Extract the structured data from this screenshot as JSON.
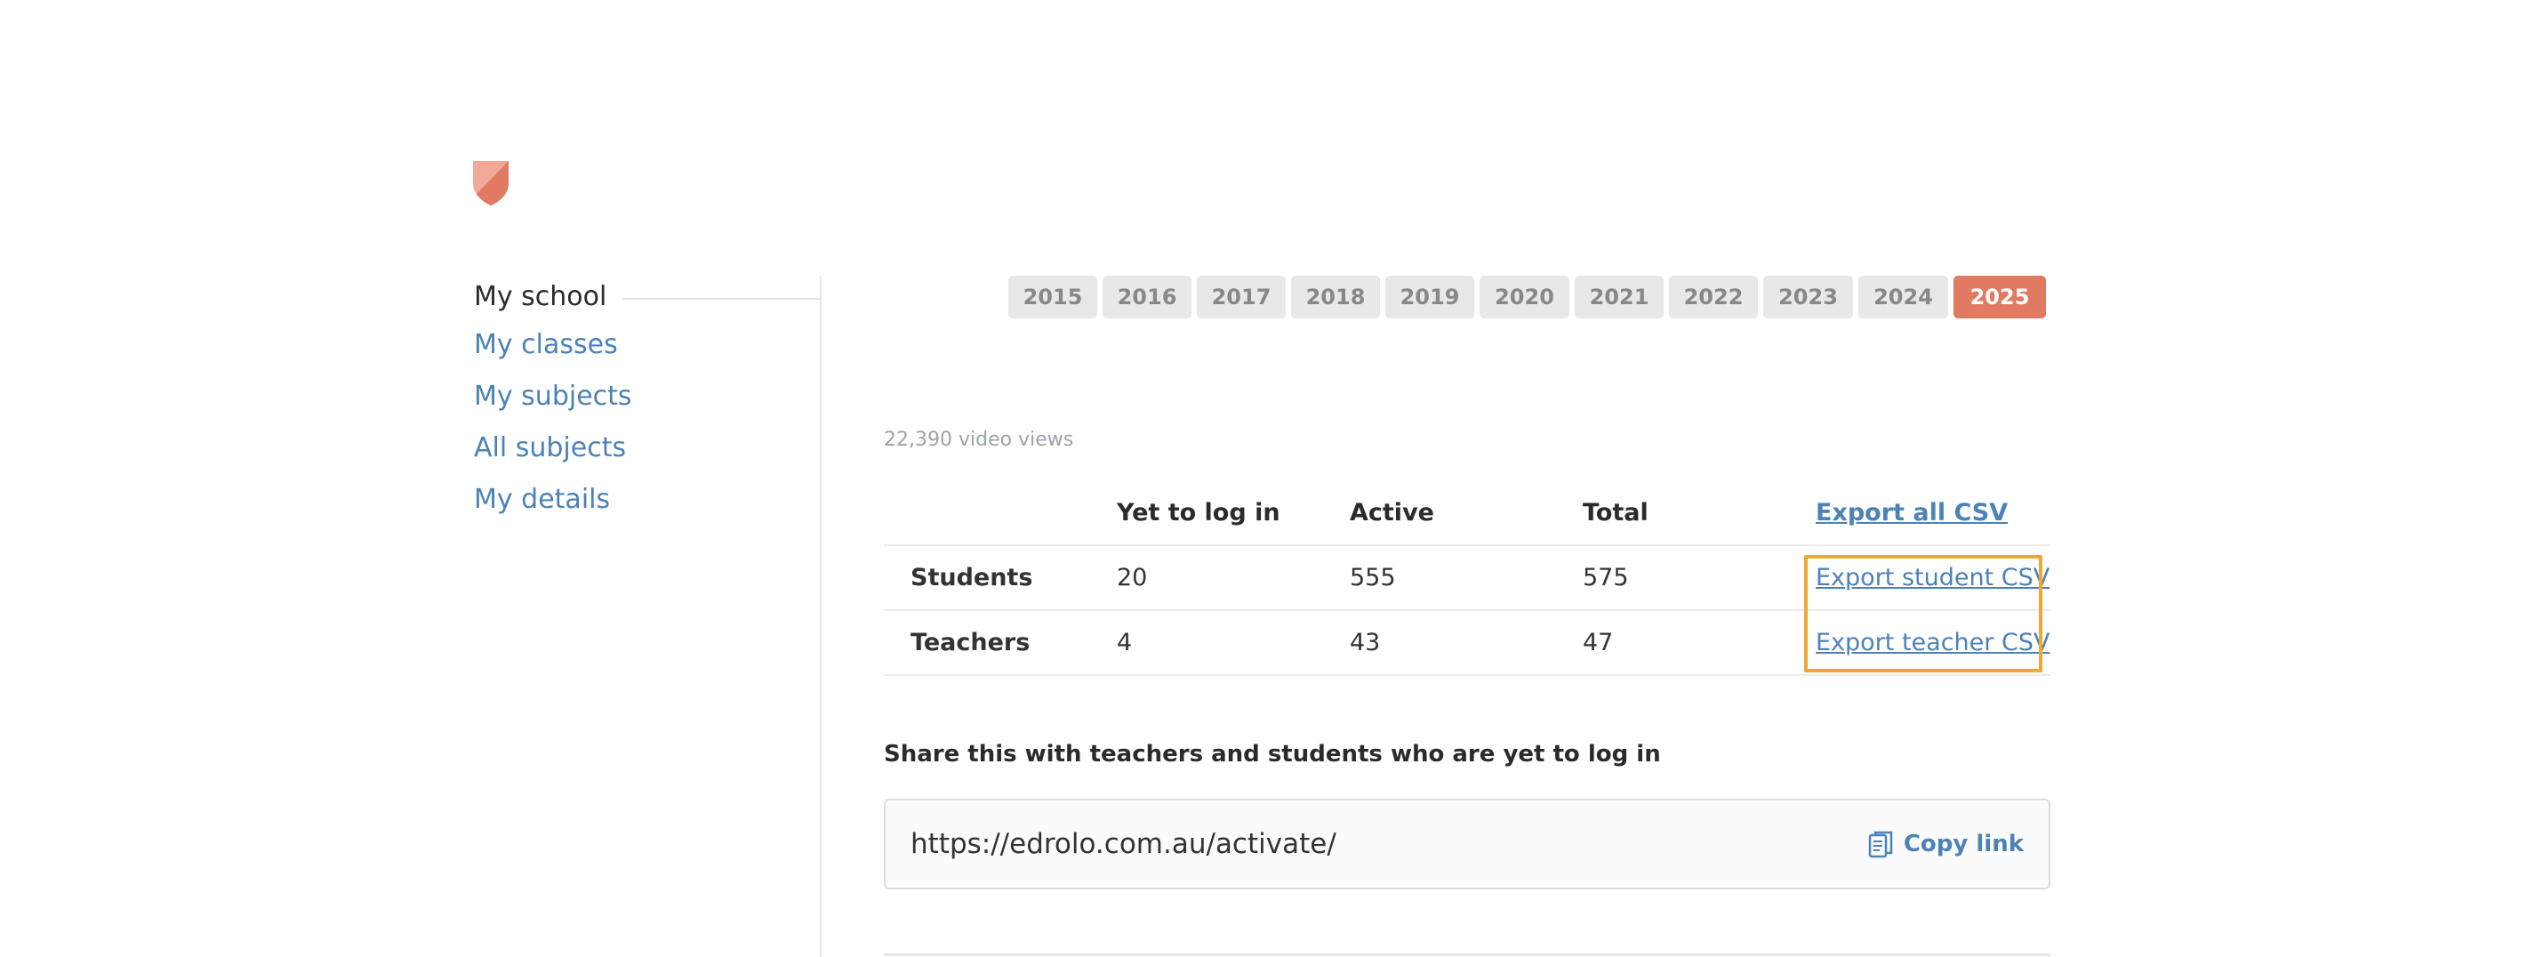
{
  "colors": {
    "accent": "#e07a63",
    "link": "#4c82b7",
    "highlight": "#f0a830"
  },
  "logo": {
    "icon": "shield-icon"
  },
  "sidebar": {
    "items": [
      {
        "label": "My school",
        "active": true
      },
      {
        "label": "My classes"
      },
      {
        "label": "My subjects"
      },
      {
        "label": "All subjects"
      },
      {
        "label": "My details"
      }
    ]
  },
  "years": {
    "options": [
      "2015",
      "2016",
      "2017",
      "2018",
      "2019",
      "2020",
      "2021",
      "2022",
      "2023",
      "2024",
      "2025"
    ],
    "selected": "2025"
  },
  "stats": {
    "video_views": "22,390 video views",
    "headers": [
      "",
      "Yet to log in",
      "Active",
      "Total"
    ],
    "export_all": "Export all CSV",
    "rows": [
      {
        "label": "Students",
        "yet": "20",
        "active": "555",
        "total": "575",
        "export": "Export student CSV"
      },
      {
        "label": "Teachers",
        "yet": "4",
        "active": "43",
        "total": "47",
        "export": "Export teacher CSV"
      }
    ]
  },
  "share": {
    "heading": "Share this with teachers and students who are yet to log in",
    "url": "https://edrolo.com.au/activate/",
    "copy_label": "Copy link",
    "copy_icon": "clipboard-icon"
  }
}
